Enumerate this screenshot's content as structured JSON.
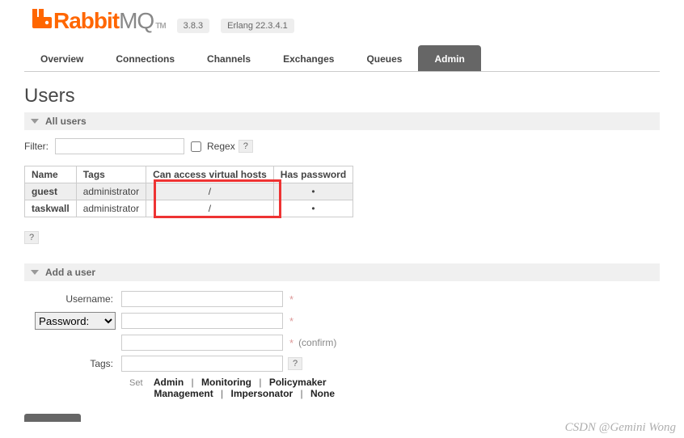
{
  "brand": {
    "name": "Rabbit",
    "suffix": "MQ",
    "tm": "TM"
  },
  "versions": {
    "app": "3.8.3",
    "erlang": "Erlang 22.3.4.1"
  },
  "tabs": [
    "Overview",
    "Connections",
    "Channels",
    "Exchanges",
    "Queues",
    "Admin"
  ],
  "active_tab": "Admin",
  "page_title": "Users",
  "sections": {
    "all_users": "All users",
    "add_user": "Add a user"
  },
  "filter": {
    "label": "Filter:",
    "regex_label": "Regex",
    "help": "?"
  },
  "table": {
    "headers": [
      "Name",
      "Tags",
      "Can access virtual hosts",
      "Has password"
    ],
    "rows": [
      {
        "name": "guest",
        "tags": "administrator",
        "vhosts": "/",
        "has_password": "•"
      },
      {
        "name": "taskwall",
        "tags": "administrator",
        "vhosts": "/",
        "has_password": "•"
      }
    ]
  },
  "help_standalone": "?",
  "add_user": {
    "username_label": "Username:",
    "password_select": "Password:",
    "confirm_label": "(confirm)",
    "tags_label": "Tags:",
    "set_label": "Set",
    "presets": [
      "Admin",
      "Monitoring",
      "Policymaker",
      "Management",
      "Impersonator",
      "None"
    ],
    "asterisk": "*",
    "help": "?"
  },
  "watermark": "CSDN @Gemini Wong"
}
